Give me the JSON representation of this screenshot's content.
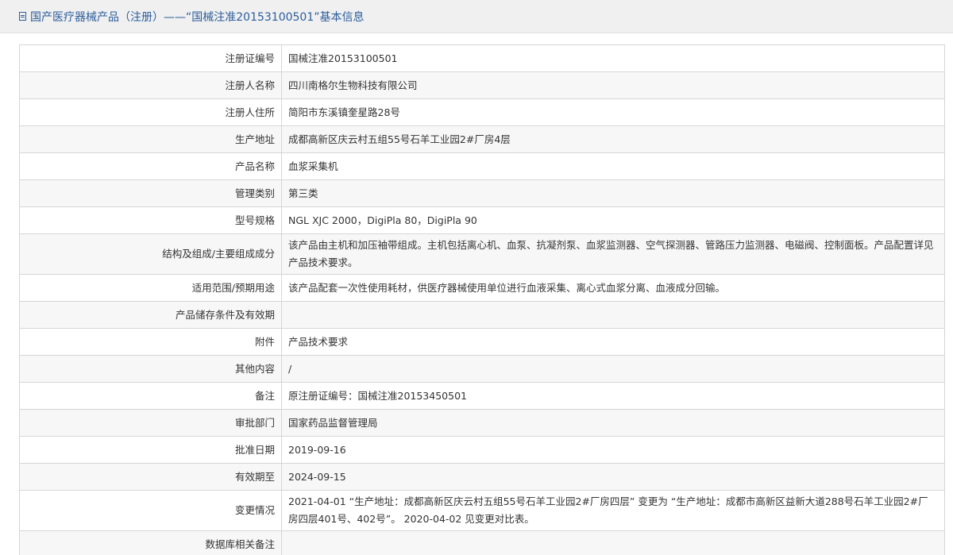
{
  "header": {
    "title": "国产医疗器械产品（注册）——“国械注准20153100501”基本信息",
    "icon": "document-icon"
  },
  "rows": [
    {
      "label": "注册证编号",
      "value": "国械注准20153100501"
    },
    {
      "label": "注册人名称",
      "value": "四川南格尔生物科技有限公司"
    },
    {
      "label": "注册人住所",
      "value": "简阳市东溪镇奎星路28号"
    },
    {
      "label": "生产地址",
      "value": "成都高新区庆云村五组55号石羊工业园2#厂房4层"
    },
    {
      "label": "产品名称",
      "value": "血浆采集机"
    },
    {
      "label": "管理类别",
      "value": "第三类"
    },
    {
      "label": "型号规格",
      "value": "NGL XJC 2000，DigiPla 80，DigiPla 90"
    },
    {
      "label": "结构及组成/主要组成成分",
      "value": "该产品由主机和加压袖带组成。主机包括离心机、血泵、抗凝剂泵、血浆监测器、空气探测器、管路压力监测器、电磁阀、控制面板。产品配置详见产品技术要求。"
    },
    {
      "label": "适用范围/预期用途",
      "value": "该产品配套一次性使用耗材，供医疗器械使用单位进行血液采集、离心式血浆分离、血液成分回输。"
    },
    {
      "label": "产品储存条件及有效期",
      "value": ""
    },
    {
      "label": "附件",
      "value": "产品技术要求"
    },
    {
      "label": "其他内容",
      "value": "/"
    },
    {
      "label": "备注",
      "value": "原注册证编号：国械注准20153450501"
    },
    {
      "label": "审批部门",
      "value": "国家药品监督管理局"
    },
    {
      "label": "批准日期",
      "value": "2019-09-16"
    },
    {
      "label": "有效期至",
      "value": "2024-09-15"
    },
    {
      "label": "变更情况",
      "value": "2021-04-01 “生产地址：成都高新区庆云村五组55号石羊工业园2#厂房四层” 变更为 “生产地址：成都市高新区益新大道288号石羊工业园2#厂房四层401号、402号”。 2020-04-02 见变更对比表。"
    },
    {
      "label": "数据库相关备注",
      "value": ""
    }
  ]
}
